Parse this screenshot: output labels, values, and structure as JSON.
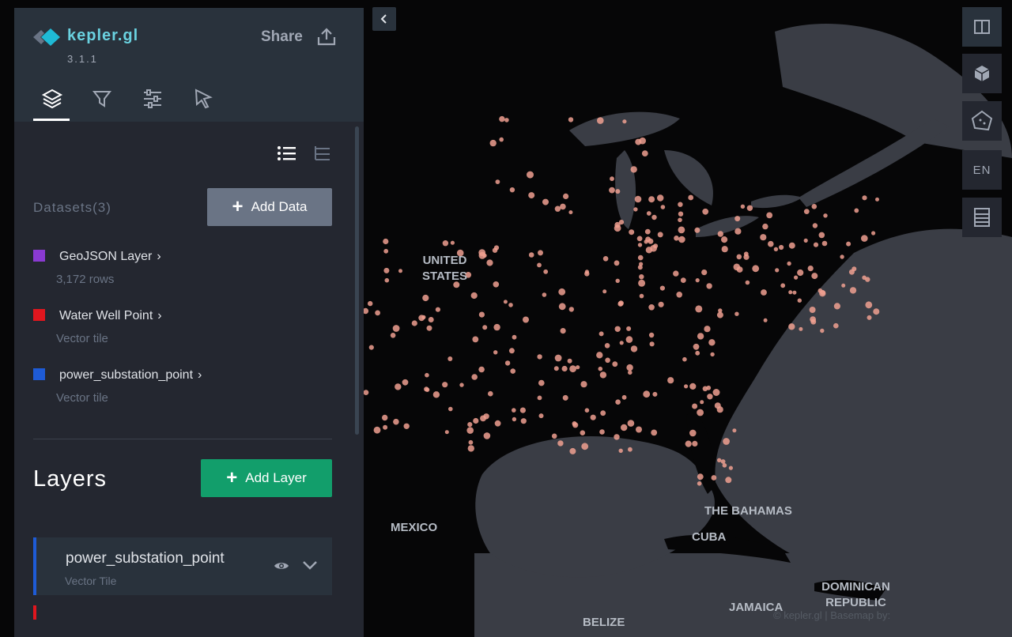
{
  "app": {
    "name": "kepler.gl",
    "version": "3.1.1",
    "share_label": "Share"
  },
  "sidebar_tabs": [
    {
      "name": "layers",
      "icon": "layers-icon",
      "active": true
    },
    {
      "name": "filters",
      "icon": "filter-icon"
    },
    {
      "name": "interactions",
      "icon": "interactions-icon"
    },
    {
      "name": "basemap",
      "icon": "cursor-icon"
    }
  ],
  "datasets": {
    "title": "Datasets(3)",
    "add_label": "Add Data",
    "items": [
      {
        "name": "GeoJSON Layer",
        "sub": "3,172 rows",
        "color": "#8a3ad1"
      },
      {
        "name": "Water Well Point",
        "sub": "Vector tile",
        "color": "#e0161e"
      },
      {
        "name": "power_substation_point",
        "sub": "Vector tile",
        "color": "#1e5bd6"
      }
    ]
  },
  "layers": {
    "title": "Layers",
    "add_label": "Add Layer",
    "items": [
      {
        "name": "power_substation_point",
        "type": "Vector Tile",
        "color": "#1e5bd6"
      }
    ]
  },
  "map": {
    "labels": [
      "UNITED STATES",
      "MEXICO",
      "THE BAHAMAS",
      "CUBA",
      "DOMINICAN REPUBLIC",
      "JAMAICA",
      "BELIZE"
    ],
    "attribution": "© kepler.gl | Basemap by:",
    "language": "EN",
    "point_color": "#f0a090"
  }
}
